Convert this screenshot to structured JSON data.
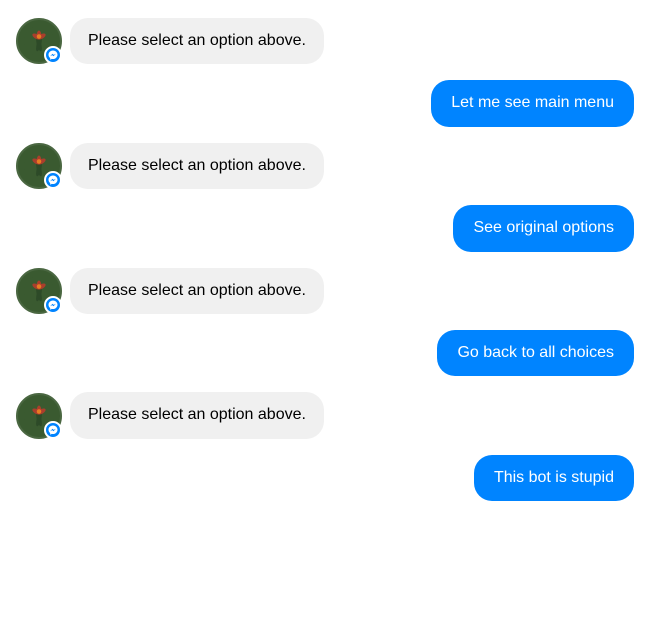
{
  "messages": [
    {
      "type": "bot",
      "text": "Please select an option above."
    },
    {
      "type": "user",
      "text": "Let me see main menu"
    },
    {
      "type": "bot",
      "text": "Please select an option above."
    },
    {
      "type": "user",
      "text": "See original options"
    },
    {
      "type": "bot",
      "text": "Please select an option above."
    },
    {
      "type": "user",
      "text": "Go back to all choices"
    },
    {
      "type": "bot",
      "text": "Please select an option above."
    },
    {
      "type": "user",
      "text": "This bot is stupid"
    }
  ]
}
